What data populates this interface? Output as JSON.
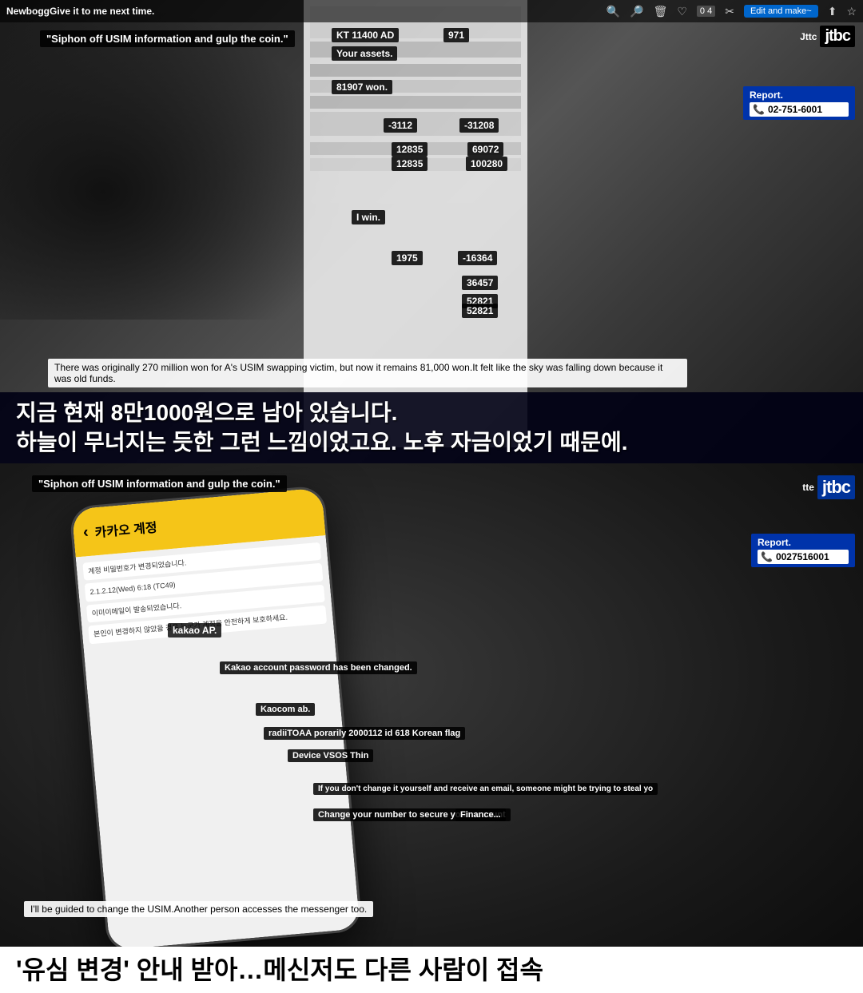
{
  "top_section": {
    "toolbar": {
      "newbogg_label": "NewboggGive it to me next time.",
      "edit_make_label": "Edit and make~",
      "counter": "0 4",
      "icons": [
        "zoom-in",
        "zoom-out",
        "trash",
        "heart",
        "crop"
      ]
    },
    "jtbc": {
      "tte_label": "Jttc",
      "logo": "jtbc"
    },
    "report": {
      "label": "Report.",
      "phone": "02-751-6001"
    },
    "siphon_subtitle": "\"Siphon off USIM information and gulp the coin.\"",
    "financial_data": {
      "kt_label": "KT 11400 AD",
      "assets_label": "Your assets.",
      "value_971": "971",
      "total_assets": "81907 won.",
      "val_neg3112": "-3112",
      "val_neg31208": "-31208",
      "val_12835a": "12835",
      "val_12835b": "12835",
      "val_69072": "69072",
      "val_100280": "100280",
      "i_win": "I win.",
      "val_1975": "1975",
      "val_neg16364": "-16364",
      "val_36457": "36457",
      "val_52821a": "52821",
      "val_52821b": "52821"
    },
    "english_subtitle": "There was originally 270 million won for A's USIM swapping victim, but now it remains 81,000 won.It felt like the sky was falling down because it was old funds.",
    "korean_subtitle_line1": "지금 현재 8만1000원으로 남아 있습니다.",
    "korean_subtitle_line2": "하늘이 무너지는 듯한 그런 느낌이었고요. 노후 자금이었기 때문에."
  },
  "bottom_section": {
    "siphon_subtitle": "\"Siphon off USIM information and gulp the coin.\"",
    "jtbc": {
      "tte_label": "tte",
      "logo": "jtbc"
    },
    "report": {
      "label": "Report.",
      "phone": "0027516001"
    },
    "kakao_ap": "kakao AP.",
    "data_boxes": {
      "kakao_changed": "Kakao account password has been changed.",
      "kaocom": "Kaocom ab.",
      "radio_toaa": "radiiTOAA porarily 2000112 id 618 Korean flag",
      "device_vsos": "Device VSOS Thin",
      "warning_msg": "If you don't change it yourself and receive an email, someone might be trying to steal yo",
      "change_number": "Change your number to secure your account",
      "finance_label": "Finance..."
    },
    "korean_banner": "'유심 변경' 안내 받아…메신저도 다른 사람이 접속",
    "english_bottom": "I'll be guided to change the USIM.Another person accesses the messenger too."
  }
}
